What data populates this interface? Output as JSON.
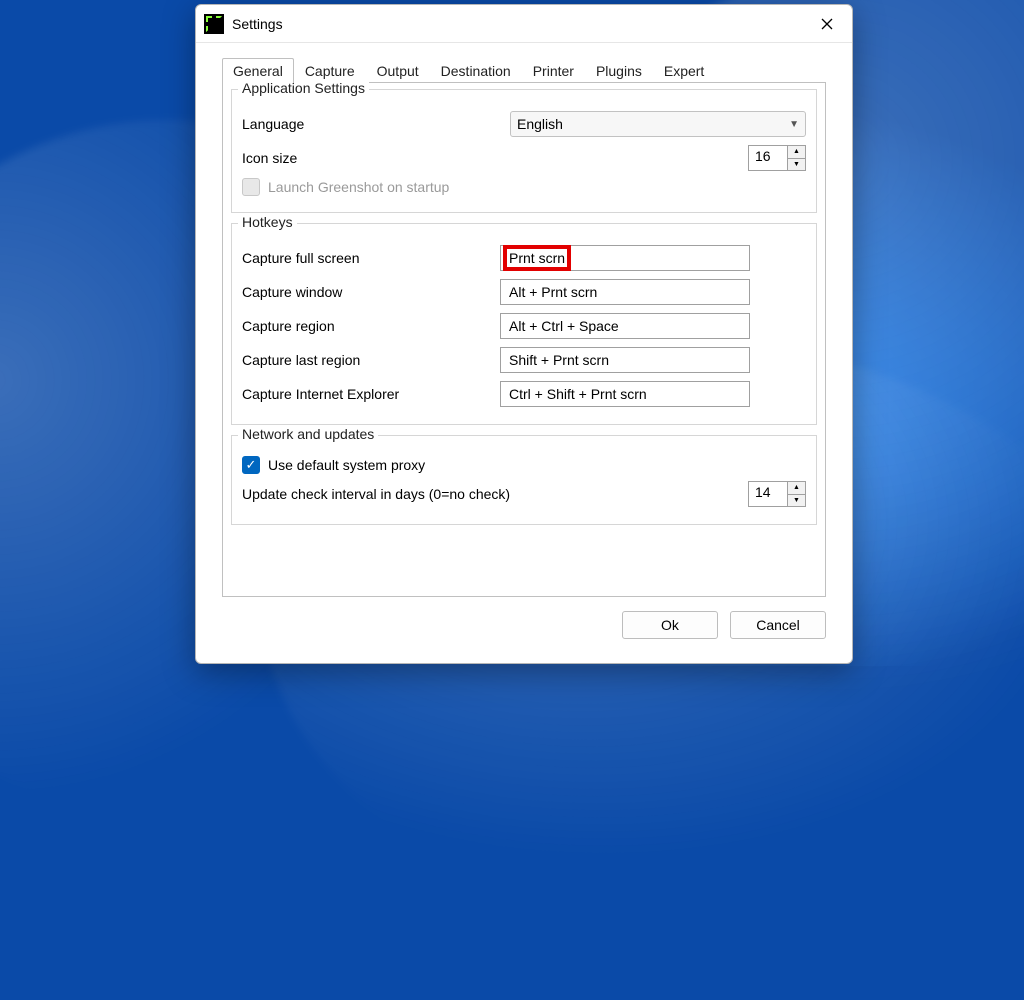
{
  "window": {
    "title": "Settings"
  },
  "tabs": {
    "items": [
      "General",
      "Capture",
      "Output",
      "Destination",
      "Printer",
      "Plugins",
      "Expert"
    ],
    "active_index": 0
  },
  "app_settings": {
    "legend": "Application Settings",
    "language_label": "Language",
    "language_value": "English",
    "icon_size_label": "Icon size",
    "icon_size_value": "16",
    "launch_on_startup_label": "Launch Greenshot on startup",
    "launch_on_startup_checked": false,
    "launch_on_startup_disabled": true
  },
  "hotkeys": {
    "legend": "Hotkeys",
    "items": [
      {
        "label": "Capture full screen",
        "value": "Prnt scrn",
        "highlighted": true
      },
      {
        "label": "Capture window",
        "value": "Alt + Prnt scrn",
        "highlighted": false
      },
      {
        "label": "Capture region",
        "value": "Alt + Ctrl + Space",
        "highlighted": false
      },
      {
        "label": "Capture last region",
        "value": "Shift + Prnt scrn",
        "highlighted": false
      },
      {
        "label": "Capture Internet Explorer",
        "value": "Ctrl + Shift + Prnt scrn",
        "highlighted": false
      }
    ]
  },
  "network": {
    "legend": "Network and updates",
    "use_proxy_label": "Use default system proxy",
    "use_proxy_checked": true,
    "update_interval_label": "Update check interval in days (0=no check)",
    "update_interval_value": "14"
  },
  "buttons": {
    "ok": "Ok",
    "cancel": "Cancel"
  }
}
